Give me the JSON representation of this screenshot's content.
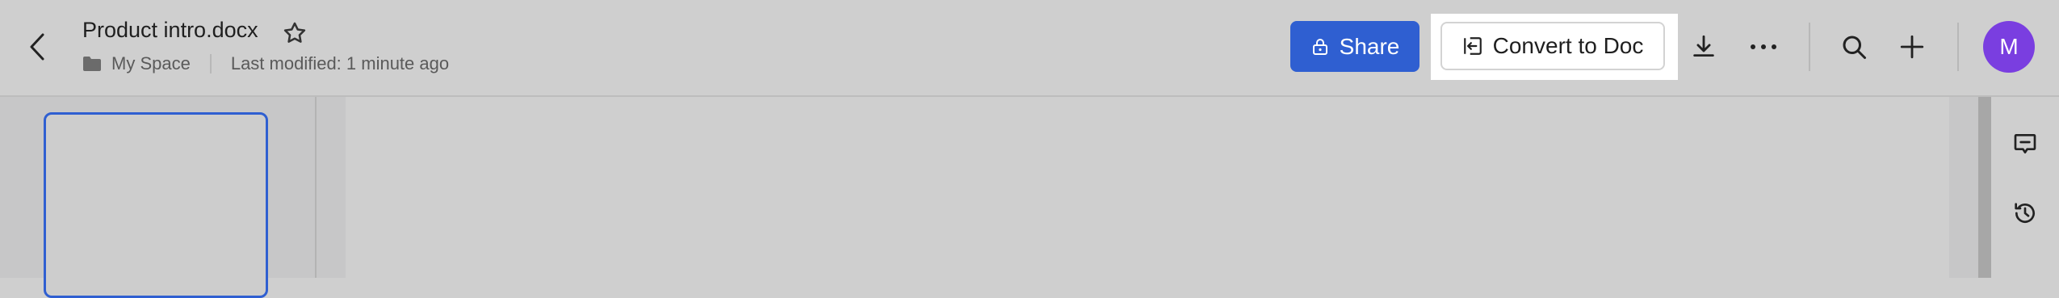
{
  "document": {
    "title": "Product intro.docx",
    "location": "My Space",
    "last_modified": "Last modified: 1 minute ago"
  },
  "toolbar": {
    "share_label": "Share",
    "convert_label": "Convert to Doc"
  },
  "user": {
    "avatar_initial": "M"
  },
  "colors": {
    "accent": "#2f5fd1",
    "avatar": "#7a3ee0",
    "background": "#cfcfcf"
  },
  "icons": {
    "back": "chevron-left-icon",
    "favorite": "star-icon",
    "folder": "folder-icon",
    "share": "lock-icon",
    "convert": "convert-icon",
    "download": "download-icon",
    "more": "more-icon",
    "search": "search-icon",
    "add": "plus-icon",
    "comments": "comment-icon",
    "history": "history-icon"
  }
}
